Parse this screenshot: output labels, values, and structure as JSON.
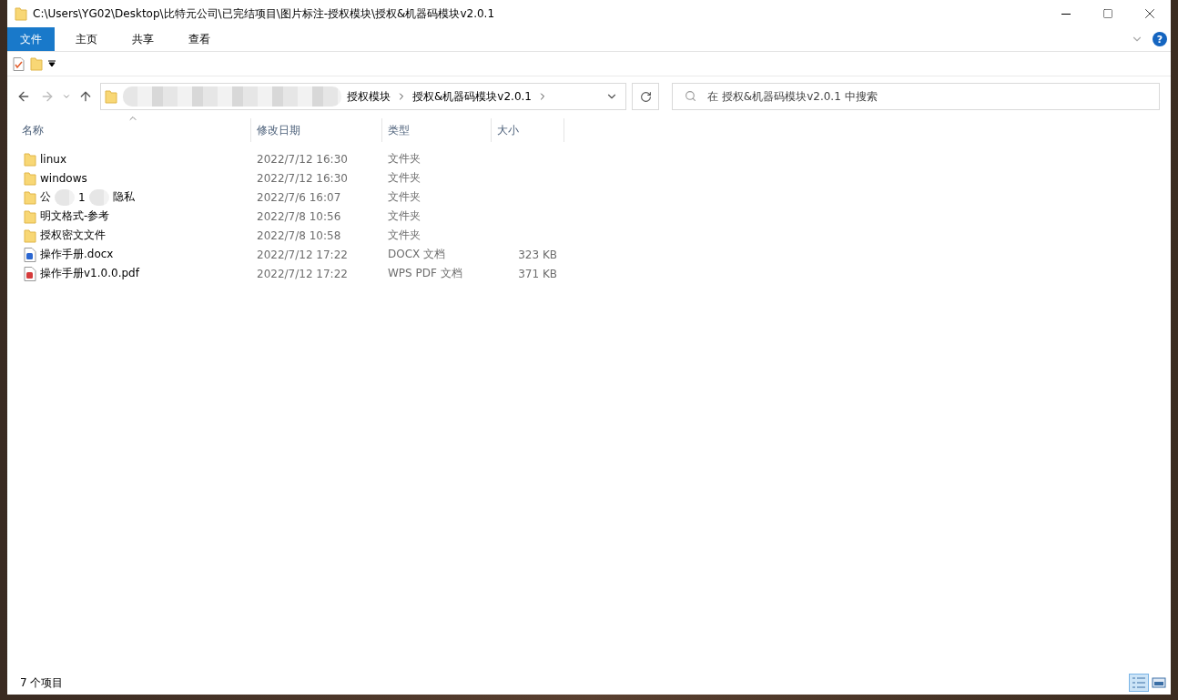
{
  "window": {
    "title": "C:\\Users\\YG02\\Desktop\\比特元公司\\已完结项目\\图片标注-授权模块\\授权&机器码模块v2.0.1"
  },
  "ribbon_tabs": [
    {
      "label": "文件",
      "selected": true
    },
    {
      "label": "主页",
      "selected": false
    },
    {
      "label": "共享",
      "selected": false
    },
    {
      "label": "查看",
      "selected": false
    }
  ],
  "address_bar": {
    "redacted": true,
    "crumbs": [
      "授权模块",
      "授权&机器码模块v2.0.1"
    ]
  },
  "help": {
    "label": "?"
  },
  "search": {
    "placeholder": "在 授权&机器码模块v2.0.1 中搜索"
  },
  "columns": [
    "名称",
    "修改日期",
    "类型",
    "大小"
  ],
  "files": [
    {
      "kind": "folder",
      "name_parts": [
        "linux"
      ],
      "date": "2022/7/12 16:30",
      "type": "文件夹"
    },
    {
      "kind": "folder",
      "name_parts": [
        "windows"
      ],
      "date": "2022/7/12 16:30",
      "type": "文件夹"
    },
    {
      "kind": "folder",
      "name_parts": [
        "公",
        "1",
        "隐私"
      ],
      "date": "2022/7/6 16:07",
      "type": "文件夹"
    },
    {
      "kind": "folder",
      "name_parts": [
        "明文格式-参考"
      ],
      "date": "2022/7/8 10:56",
      "type": "文件夹"
    },
    {
      "kind": "folder",
      "name_parts": [
        "授权密文文件"
      ],
      "date": "2022/7/8 10:58",
      "type": "文件夹"
    },
    {
      "kind": "docx",
      "name_parts": [
        "操作手册.docx"
      ],
      "date": "2022/7/12 17:22",
      "type": "DOCX 文档",
      "size": "323 KB"
    },
    {
      "kind": "pdf",
      "name_parts": [
        "操作手册v1.0.0.pdf"
      ],
      "date": "2022/7/12 17:22",
      "type": "WPS PDF 文档",
      "size": "371 KB"
    }
  ],
  "status_bar": {
    "count": "7 个项目"
  },
  "views": [
    {
      "kind": "details",
      "selected": true
    },
    {
      "kind": "tiles",
      "selected": false
    }
  ]
}
